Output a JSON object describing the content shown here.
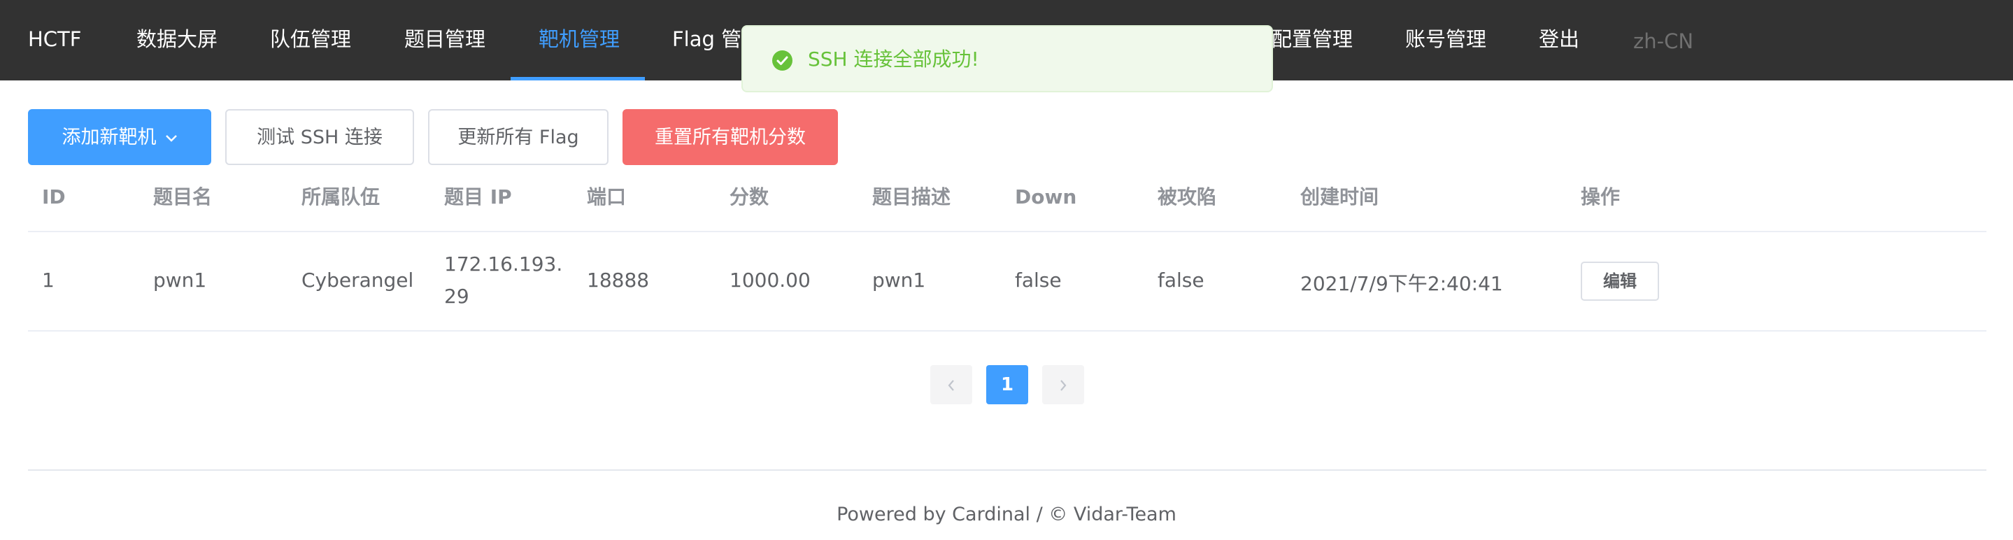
{
  "nav": {
    "brand": "HCTF",
    "items": [
      "数据大屏",
      "队伍管理",
      "题目管理",
      "靶机管理",
      "Flag 管理",
      "配置管理",
      "账号管理",
      "登出"
    ],
    "active_index": 3,
    "lang": "zh-CN"
  },
  "toast": {
    "message": "SSH 连接全部成功!",
    "type": "success"
  },
  "toolbar": {
    "add_label": "添加新靶机",
    "test_ssh_label": "测试 SSH 连接",
    "refresh_flag_label": "更新所有 Flag",
    "reset_scores_label": "重置所有靶机分数"
  },
  "table": {
    "columns": [
      "ID",
      "题目名",
      "所属队伍",
      "题目 IP",
      "端口",
      "分数",
      "题目描述",
      "Down",
      "被攻陷",
      "创建时间",
      "操作"
    ],
    "rows": [
      {
        "id": "1",
        "challenge": "pwn1",
        "team": "Cyberangel",
        "ip": "172.16.193.29",
        "port": "18888",
        "score": "1000.00",
        "description": "pwn1",
        "down": "false",
        "attacked": "false",
        "created_at": "2021/7/9下午2:40:41",
        "action_label": "编辑"
      }
    ]
  },
  "pagination": {
    "current_page": "1",
    "prev_icon": "chevron-left-icon",
    "next_icon": "chevron-right-icon"
  },
  "footer": {
    "text": "Powered by Cardinal / © Vidar-Team"
  },
  "colors": {
    "nav_bg": "#323232",
    "accent": "#409eff",
    "danger": "#f56c6c",
    "success": "#67c23a",
    "success_bg": "#f0f9eb"
  }
}
